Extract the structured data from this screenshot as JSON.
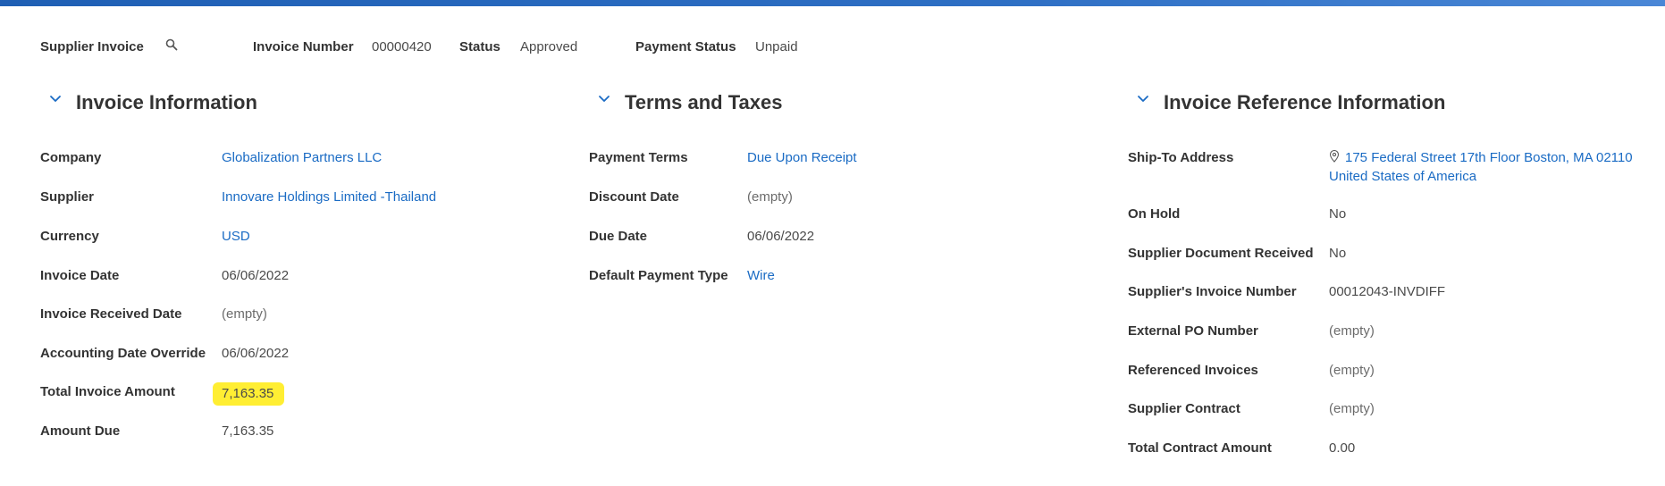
{
  "header": {
    "supplier_invoice_label": "Supplier Invoice",
    "invoice_number_label": "Invoice Number",
    "invoice_number": "00000420",
    "status_label": "Status",
    "status": "Approved",
    "payment_status_label": "Payment Status",
    "payment_status": "Unpaid"
  },
  "sections": {
    "invoice_information": {
      "title": "Invoice Information",
      "fields": [
        {
          "label": "Company",
          "value": "Globalization Partners LLC"
        },
        {
          "label": "Supplier",
          "value": "Innovare Holdings Limited -Thailand"
        },
        {
          "label": "Currency",
          "value": "USD"
        },
        {
          "label": "Invoice Date",
          "value": "06/06/2022"
        },
        {
          "label": "Invoice Received Date",
          "value": "(empty)"
        },
        {
          "label": "Accounting Date Override",
          "value": "06/06/2022"
        },
        {
          "label": "Total Invoice Amount",
          "value": "7,163.35"
        },
        {
          "label": "Amount Due",
          "value": "7,163.35"
        }
      ]
    },
    "terms_and_taxes": {
      "title": "Terms and Taxes",
      "fields": [
        {
          "label": "Payment Terms",
          "value": "Due Upon Receipt"
        },
        {
          "label": "Discount Date",
          "value": "(empty)"
        },
        {
          "label": "Due Date",
          "value": "06/06/2022"
        },
        {
          "label": "Default Payment Type",
          "value": "Wire"
        }
      ]
    },
    "invoice_reference": {
      "title": "Invoice Reference Information",
      "fields": [
        {
          "label": "Ship-To Address",
          "value_line1": "175 Federal Street 17th Floor Boston, MA 02110",
          "value_line2": "United States of America"
        },
        {
          "label": "On Hold",
          "value": "No"
        },
        {
          "label": "Supplier Document Received",
          "value": "No"
        },
        {
          "label": "Supplier's Invoice Number",
          "value": "00012043-INVDIFF"
        },
        {
          "label": "External PO Number",
          "value": "(empty)"
        },
        {
          "label": "Referenced Invoices",
          "value": "(empty)"
        },
        {
          "label": "Supplier Contract",
          "value": "(empty)"
        },
        {
          "label": "Total Contract Amount",
          "value": "0.00"
        }
      ]
    }
  },
  "icons": {
    "search": "search-icon",
    "chevron": "chevron-down-icon",
    "location": "location-pin-icon"
  },
  "colors": {
    "link": "#1a6bc4",
    "highlight": "#ffee33",
    "top_bar": "#2e6fc4"
  }
}
